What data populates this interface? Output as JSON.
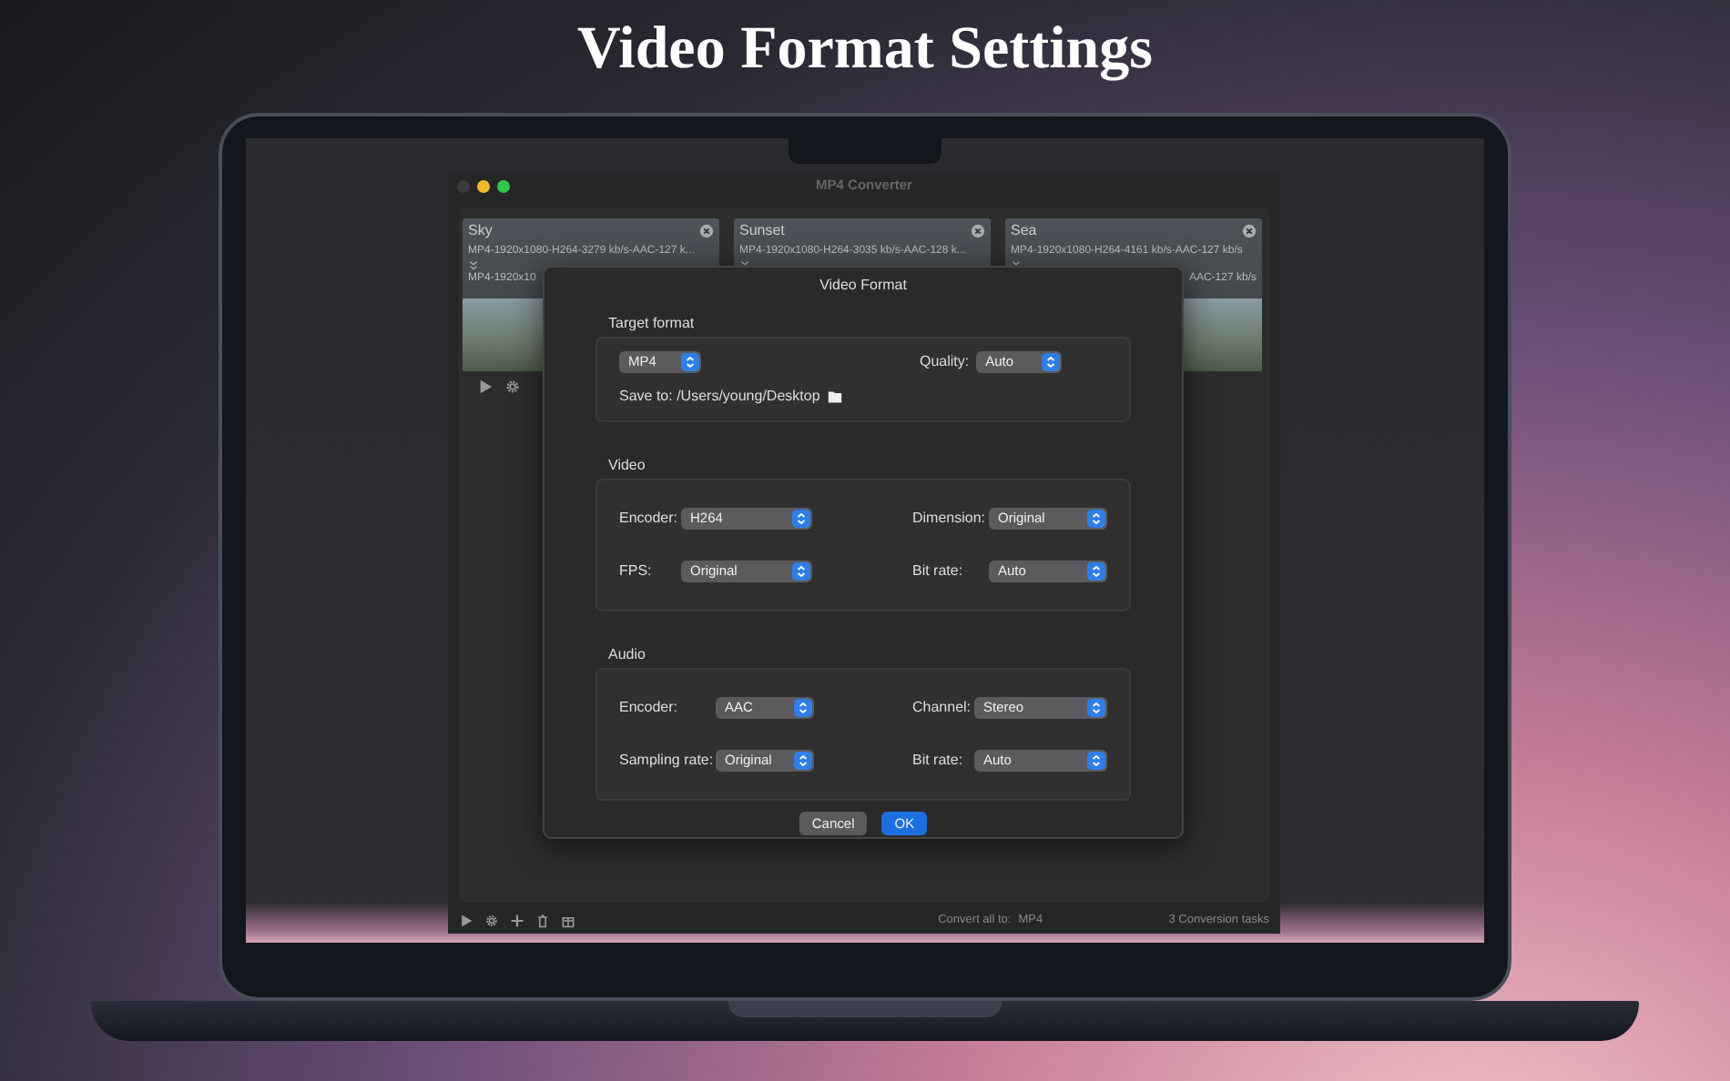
{
  "page_title": "Video Format Settings",
  "window": {
    "title": "MP4 Converter"
  },
  "tasks": [
    {
      "name": "Sky",
      "format": "MP4-1920x1080-H264-3279 kb/s-AAC-127 k...",
      "kind": "head",
      "second_line": "MP4-1920x10"
    },
    {
      "name": "Sunset",
      "format": "MP4-1920x1080-H264-3035 kb/s-AAC-128 k...",
      "kind": "covered"
    },
    {
      "name": "Sea",
      "format": "MP4-1920x1080-H264-4161 kb/s-AAC-127 kb/s",
      "kind": "tail",
      "second_line": "AAC-127 kb/s"
    }
  ],
  "dialog": {
    "title": "Video Format",
    "target": {
      "title": "Target format",
      "format": {
        "value": "MP4"
      },
      "quality": {
        "label": "Quality:",
        "value": "Auto"
      },
      "save_to": "Save to: /Users/young/Desktop"
    },
    "sections": [
      {
        "title": "Video",
        "kind": "video",
        "fields": [
          {
            "label": "Encoder:",
            "value": "H264"
          },
          {
            "label": "Dimension:",
            "value": "Original"
          },
          {
            "label": "FPS:",
            "value": "Original"
          },
          {
            "label": "Bit rate:",
            "value": "Auto"
          }
        ]
      },
      {
        "title": "Audio",
        "kind": "audio",
        "fields": [
          {
            "label": "Encoder:",
            "value": "AAC"
          },
          {
            "label": "Channel:",
            "value": "Stereo"
          },
          {
            "label": "Sampling rate:",
            "value": "Original"
          },
          {
            "label": "Bit rate:",
            "value": "Auto"
          }
        ]
      }
    ],
    "buttons": [
      {
        "label": "Cancel",
        "default": false
      },
      {
        "label": "OK",
        "default": true
      }
    ]
  },
  "footer": {
    "convert_label": "Convert all to:",
    "convert_value": "MP4",
    "task_count": "3 Conversion tasks"
  }
}
